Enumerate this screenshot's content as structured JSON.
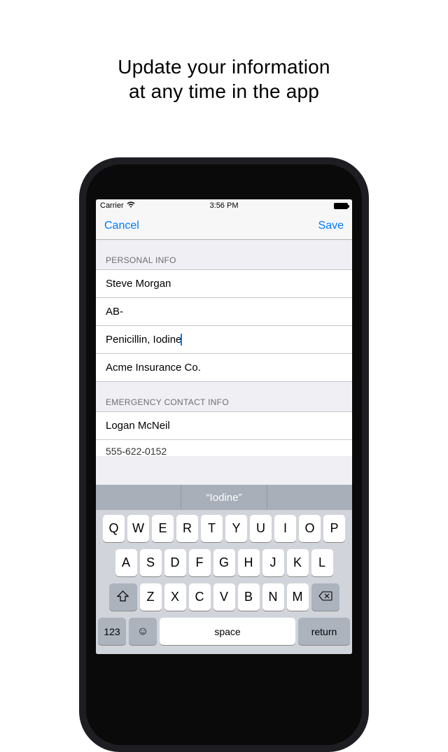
{
  "promo": {
    "line1": "Update your information",
    "line2": "at any time in the app"
  },
  "status": {
    "carrier": "Carrier",
    "time": "3:56 PM"
  },
  "nav": {
    "cancel": "Cancel",
    "save": "Save"
  },
  "sections": {
    "personal": {
      "header": "PERSONAL INFO",
      "name": "Steve Morgan",
      "bloodType": "AB-",
      "allergies": "Penicillin, Iodine",
      "insurance": "Acme Insurance Co."
    },
    "emergency": {
      "header": "EMERGENCY CONTACT INFO",
      "name": "Logan McNeil",
      "phone": "555-622-0152"
    }
  },
  "suggestion": "“Iodine”",
  "keyboard": {
    "row1": [
      "Q",
      "W",
      "E",
      "R",
      "T",
      "Y",
      "U",
      "I",
      "O",
      "P"
    ],
    "row2": [
      "A",
      "S",
      "D",
      "F",
      "G",
      "H",
      "J",
      "K",
      "L"
    ],
    "row3": [
      "Z",
      "X",
      "C",
      "V",
      "B",
      "N",
      "M"
    ],
    "numbers": "123",
    "space": "space",
    "return": "return"
  }
}
